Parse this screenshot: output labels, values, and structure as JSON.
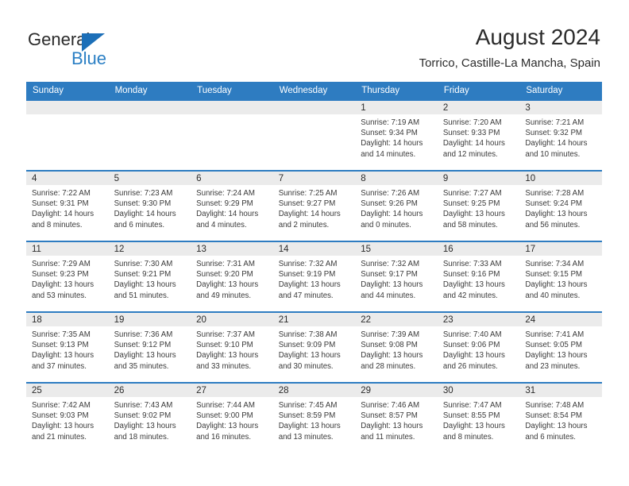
{
  "brand": {
    "name_top": "General",
    "name_bottom": "Blue",
    "accent_color": "#2a7fc4",
    "triangle_color": "#1c6fb8"
  },
  "header": {
    "title": "August 2024",
    "subtitle": "Torrico, Castille-La Mancha, Spain"
  },
  "calendar": {
    "header_bg": "#2e7cc1",
    "daynum_bg": "#ebebeb",
    "weekday_headers": [
      "Sunday",
      "Monday",
      "Tuesday",
      "Wednesday",
      "Thursday",
      "Friday",
      "Saturday"
    ],
    "weeks": [
      [
        {
          "day": "",
          "sunrise": "",
          "sunset": "",
          "daylight_a": "",
          "daylight_b": ""
        },
        {
          "day": "",
          "sunrise": "",
          "sunset": "",
          "daylight_a": "",
          "daylight_b": ""
        },
        {
          "day": "",
          "sunrise": "",
          "sunset": "",
          "daylight_a": "",
          "daylight_b": ""
        },
        {
          "day": "",
          "sunrise": "",
          "sunset": "",
          "daylight_a": "",
          "daylight_b": ""
        },
        {
          "day": "1",
          "sunrise": "Sunrise: 7:19 AM",
          "sunset": "Sunset: 9:34 PM",
          "daylight_a": "Daylight: 14 hours",
          "daylight_b": "and 14 minutes."
        },
        {
          "day": "2",
          "sunrise": "Sunrise: 7:20 AM",
          "sunset": "Sunset: 9:33 PM",
          "daylight_a": "Daylight: 14 hours",
          "daylight_b": "and 12 minutes."
        },
        {
          "day": "3",
          "sunrise": "Sunrise: 7:21 AM",
          "sunset": "Sunset: 9:32 PM",
          "daylight_a": "Daylight: 14 hours",
          "daylight_b": "and 10 minutes."
        }
      ],
      [
        {
          "day": "4",
          "sunrise": "Sunrise: 7:22 AM",
          "sunset": "Sunset: 9:31 PM",
          "daylight_a": "Daylight: 14 hours",
          "daylight_b": "and 8 minutes."
        },
        {
          "day": "5",
          "sunrise": "Sunrise: 7:23 AM",
          "sunset": "Sunset: 9:30 PM",
          "daylight_a": "Daylight: 14 hours",
          "daylight_b": "and 6 minutes."
        },
        {
          "day": "6",
          "sunrise": "Sunrise: 7:24 AM",
          "sunset": "Sunset: 9:29 PM",
          "daylight_a": "Daylight: 14 hours",
          "daylight_b": "and 4 minutes."
        },
        {
          "day": "7",
          "sunrise": "Sunrise: 7:25 AM",
          "sunset": "Sunset: 9:27 PM",
          "daylight_a": "Daylight: 14 hours",
          "daylight_b": "and 2 minutes."
        },
        {
          "day": "8",
          "sunrise": "Sunrise: 7:26 AM",
          "sunset": "Sunset: 9:26 PM",
          "daylight_a": "Daylight: 14 hours",
          "daylight_b": "and 0 minutes."
        },
        {
          "day": "9",
          "sunrise": "Sunrise: 7:27 AM",
          "sunset": "Sunset: 9:25 PM",
          "daylight_a": "Daylight: 13 hours",
          "daylight_b": "and 58 minutes."
        },
        {
          "day": "10",
          "sunrise": "Sunrise: 7:28 AM",
          "sunset": "Sunset: 9:24 PM",
          "daylight_a": "Daylight: 13 hours",
          "daylight_b": "and 56 minutes."
        }
      ],
      [
        {
          "day": "11",
          "sunrise": "Sunrise: 7:29 AM",
          "sunset": "Sunset: 9:23 PM",
          "daylight_a": "Daylight: 13 hours",
          "daylight_b": "and 53 minutes."
        },
        {
          "day": "12",
          "sunrise": "Sunrise: 7:30 AM",
          "sunset": "Sunset: 9:21 PM",
          "daylight_a": "Daylight: 13 hours",
          "daylight_b": "and 51 minutes."
        },
        {
          "day": "13",
          "sunrise": "Sunrise: 7:31 AM",
          "sunset": "Sunset: 9:20 PM",
          "daylight_a": "Daylight: 13 hours",
          "daylight_b": "and 49 minutes."
        },
        {
          "day": "14",
          "sunrise": "Sunrise: 7:32 AM",
          "sunset": "Sunset: 9:19 PM",
          "daylight_a": "Daylight: 13 hours",
          "daylight_b": "and 47 minutes."
        },
        {
          "day": "15",
          "sunrise": "Sunrise: 7:32 AM",
          "sunset": "Sunset: 9:17 PM",
          "daylight_a": "Daylight: 13 hours",
          "daylight_b": "and 44 minutes."
        },
        {
          "day": "16",
          "sunrise": "Sunrise: 7:33 AM",
          "sunset": "Sunset: 9:16 PM",
          "daylight_a": "Daylight: 13 hours",
          "daylight_b": "and 42 minutes."
        },
        {
          "day": "17",
          "sunrise": "Sunrise: 7:34 AM",
          "sunset": "Sunset: 9:15 PM",
          "daylight_a": "Daylight: 13 hours",
          "daylight_b": "and 40 minutes."
        }
      ],
      [
        {
          "day": "18",
          "sunrise": "Sunrise: 7:35 AM",
          "sunset": "Sunset: 9:13 PM",
          "daylight_a": "Daylight: 13 hours",
          "daylight_b": "and 37 minutes."
        },
        {
          "day": "19",
          "sunrise": "Sunrise: 7:36 AM",
          "sunset": "Sunset: 9:12 PM",
          "daylight_a": "Daylight: 13 hours",
          "daylight_b": "and 35 minutes."
        },
        {
          "day": "20",
          "sunrise": "Sunrise: 7:37 AM",
          "sunset": "Sunset: 9:10 PM",
          "daylight_a": "Daylight: 13 hours",
          "daylight_b": "and 33 minutes."
        },
        {
          "day": "21",
          "sunrise": "Sunrise: 7:38 AM",
          "sunset": "Sunset: 9:09 PM",
          "daylight_a": "Daylight: 13 hours",
          "daylight_b": "and 30 minutes."
        },
        {
          "day": "22",
          "sunrise": "Sunrise: 7:39 AM",
          "sunset": "Sunset: 9:08 PM",
          "daylight_a": "Daylight: 13 hours",
          "daylight_b": "and 28 minutes."
        },
        {
          "day": "23",
          "sunrise": "Sunrise: 7:40 AM",
          "sunset": "Sunset: 9:06 PM",
          "daylight_a": "Daylight: 13 hours",
          "daylight_b": "and 26 minutes."
        },
        {
          "day": "24",
          "sunrise": "Sunrise: 7:41 AM",
          "sunset": "Sunset: 9:05 PM",
          "daylight_a": "Daylight: 13 hours",
          "daylight_b": "and 23 minutes."
        }
      ],
      [
        {
          "day": "25",
          "sunrise": "Sunrise: 7:42 AM",
          "sunset": "Sunset: 9:03 PM",
          "daylight_a": "Daylight: 13 hours",
          "daylight_b": "and 21 minutes."
        },
        {
          "day": "26",
          "sunrise": "Sunrise: 7:43 AM",
          "sunset": "Sunset: 9:02 PM",
          "daylight_a": "Daylight: 13 hours",
          "daylight_b": "and 18 minutes."
        },
        {
          "day": "27",
          "sunrise": "Sunrise: 7:44 AM",
          "sunset": "Sunset: 9:00 PM",
          "daylight_a": "Daylight: 13 hours",
          "daylight_b": "and 16 minutes."
        },
        {
          "day": "28",
          "sunrise": "Sunrise: 7:45 AM",
          "sunset": "Sunset: 8:59 PM",
          "daylight_a": "Daylight: 13 hours",
          "daylight_b": "and 13 minutes."
        },
        {
          "day": "29",
          "sunrise": "Sunrise: 7:46 AM",
          "sunset": "Sunset: 8:57 PM",
          "daylight_a": "Daylight: 13 hours",
          "daylight_b": "and 11 minutes."
        },
        {
          "day": "30",
          "sunrise": "Sunrise: 7:47 AM",
          "sunset": "Sunset: 8:55 PM",
          "daylight_a": "Daylight: 13 hours",
          "daylight_b": "and 8 minutes."
        },
        {
          "day": "31",
          "sunrise": "Sunrise: 7:48 AM",
          "sunset": "Sunset: 8:54 PM",
          "daylight_a": "Daylight: 13 hours",
          "daylight_b": "and 6 minutes."
        }
      ]
    ]
  }
}
